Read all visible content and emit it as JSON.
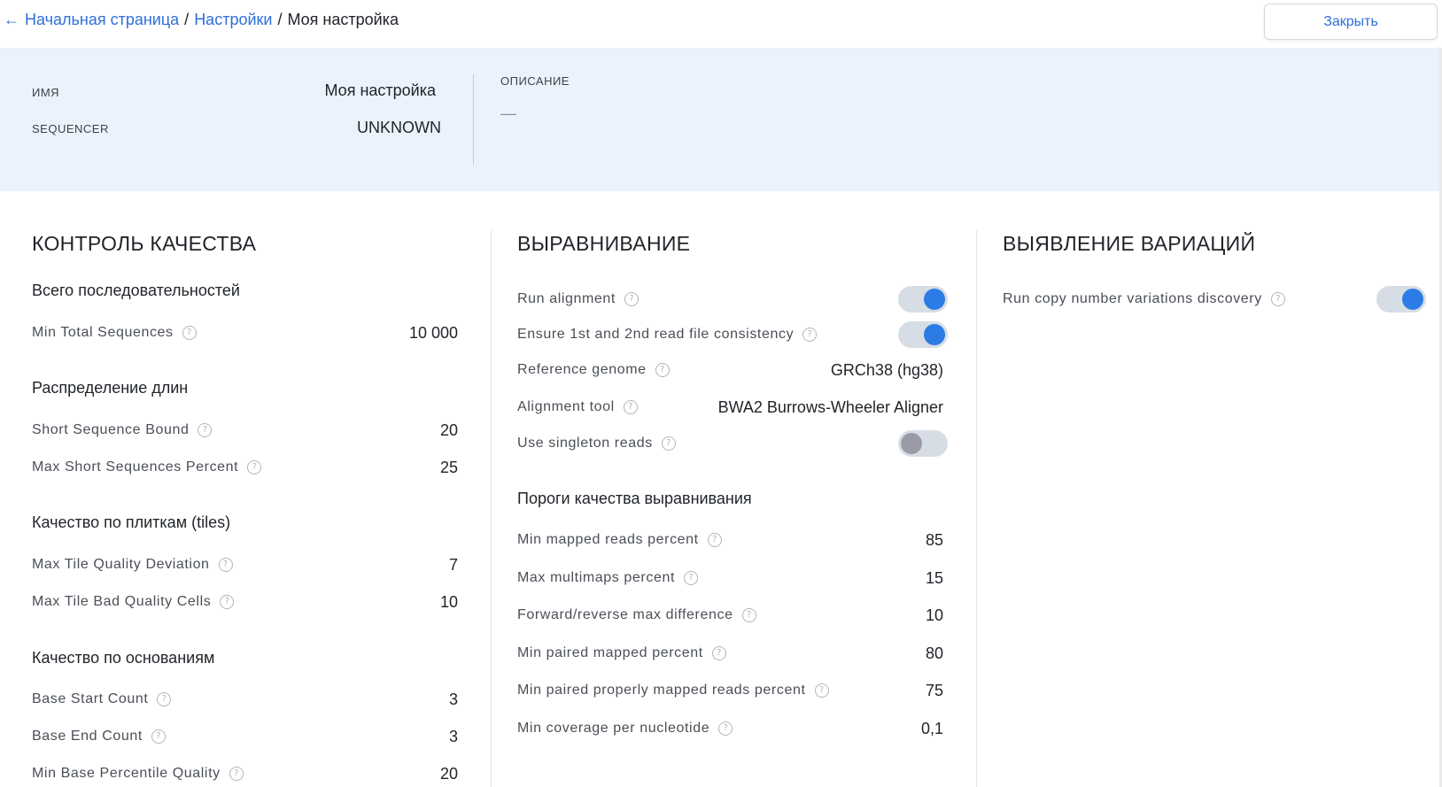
{
  "breadcrumb": {
    "items": [
      {
        "label": "Начальная страница"
      },
      {
        "label": "Настройки"
      }
    ],
    "separator": "/",
    "current": "Моя настройка"
  },
  "header": {
    "close_label": "Закрыть"
  },
  "info": {
    "name_label": "ИМЯ",
    "name_value": "Моя настройка",
    "sequencer_label": "SEQUENCER",
    "sequencer_value": "UNKNOWN",
    "description_label": "ОПИСАНИЕ",
    "description_value": "—"
  },
  "qc": {
    "title": "КОНТРОЛЬ КАЧЕСТВА",
    "groups": [
      {
        "title": "Всего последовательностей",
        "rows": [
          {
            "label": "Min Total Sequences",
            "value": "10 000"
          }
        ]
      },
      {
        "title": "Распределение длин",
        "rows": [
          {
            "label": "Short Sequence Bound",
            "value": "20"
          },
          {
            "label": "Max Short Sequences Percent",
            "value": "25"
          }
        ]
      },
      {
        "title": "Качество по плиткам (tiles)",
        "rows": [
          {
            "label": "Max Tile Quality Deviation",
            "value": "7"
          },
          {
            "label": "Max Tile Bad Quality Cells",
            "value": "10"
          }
        ]
      },
      {
        "title": "Качество по основаниям",
        "rows": [
          {
            "label": "Base Start Count",
            "value": "3"
          },
          {
            "label": "Base End Count",
            "value": "3"
          },
          {
            "label": "Min Base Percentile Quality",
            "value": "20"
          }
        ]
      }
    ]
  },
  "alignment": {
    "title": "ВЫРАВНИВАНИЕ",
    "rows": [
      {
        "label": "Run alignment",
        "toggle": true
      },
      {
        "label": "Ensure 1st and 2nd read file consistency",
        "toggle": true
      },
      {
        "label": "Reference genome",
        "value": "GRCh38 (hg38)"
      },
      {
        "label": "Alignment tool",
        "value": "BWA2 Burrows-Wheeler Aligner"
      },
      {
        "label": "Use singleton reads",
        "toggle": false
      }
    ],
    "thresholds_title": "Пороги качества выравнивания",
    "thresholds": [
      {
        "label": "Min mapped reads percent",
        "value": "85"
      },
      {
        "label": "Max multimaps percent",
        "value": "15"
      },
      {
        "label": "Forward/reverse max difference",
        "value": "10"
      },
      {
        "label": "Min paired mapped percent",
        "value": "80"
      },
      {
        "label": "Min paired properly mapped reads percent",
        "value": "75"
      },
      {
        "label": "Min coverage per nucleotide",
        "value": "0,1"
      }
    ]
  },
  "variants": {
    "title": "ВЫЯВЛЕНИЕ ВАРИАЦИЙ",
    "rows": [
      {
        "label": "Run copy number variations discovery",
        "toggle": true
      }
    ]
  },
  "icons": {
    "back": "arrow-left-icon",
    "help": "question-circle-icon"
  },
  "colors": {
    "accent": "#2f6fdb",
    "toggle_on": "#2d7be5",
    "info_bg": "#eaf3fc"
  }
}
